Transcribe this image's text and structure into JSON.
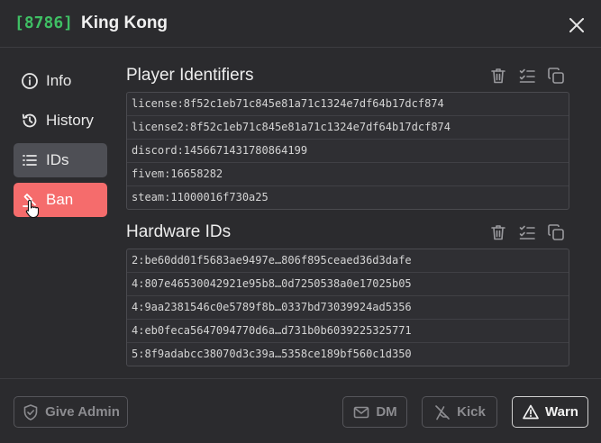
{
  "header": {
    "player_id": "[8786]",
    "player_name": "King Kong"
  },
  "sidebar": {
    "items": [
      {
        "label": "Info",
        "icon": "info-icon"
      },
      {
        "label": "History",
        "icon": "history-icon"
      },
      {
        "label": "IDs",
        "icon": "list-icon",
        "state": "active"
      },
      {
        "label": "Ban",
        "icon": "gavel-icon",
        "state": "danger"
      }
    ]
  },
  "player_identifiers": {
    "title": "Player Identifiers",
    "rows": [
      "license:8f52c1eb71c845e81a71c1324e7df64b17dcf874",
      "license2:8f52c1eb71c845e81a71c1324e7df64b17dcf874",
      "discord:1456671431780864199",
      "fivem:16658282",
      "steam:11000016f730a25"
    ]
  },
  "hardware_ids": {
    "title": "Hardware IDs",
    "rows": [
      "2:be60dd01f5683ae9497e…806f895ceaed36d3dafe",
      "4:807e46530042921e95b8…0d7250538a0e17025b05",
      "4:9aa2381546c0e5789f8b…0337bd73039924ad5356",
      "4:eb0feca5647094770d6a…d731b0b6039225325771",
      "5:8f9adabcc38070d3c39a…5358ce189bf560c1d350"
    ]
  },
  "footer": {
    "give_admin": "Give Admin",
    "dm": "DM",
    "kick": "Kick",
    "warn": "Warn"
  },
  "colors": {
    "background": "#2b2b2e",
    "accent_green": "#3fbf64",
    "danger": "#f56c6c",
    "active_item": "#4e4f55"
  }
}
